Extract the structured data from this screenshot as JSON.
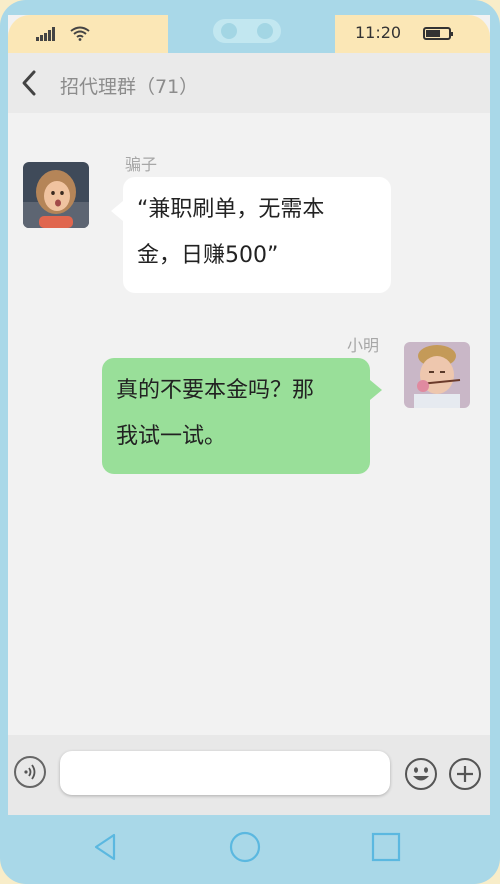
{
  "status_bar": {
    "time": "11:20",
    "signal_icon": "signal-icon",
    "wifi_icon": "wifi-icon",
    "battery_icon": "battery-icon"
  },
  "header": {
    "title": "招代理群（71）",
    "back_icon": "chevron-left-icon"
  },
  "messages": [
    {
      "sender": "骗子",
      "text_line1": "“兼职刷单，无需本",
      "text_line2": "金，日赚500”",
      "side": "left"
    },
    {
      "sender": "小明",
      "text_line1": "真的不要本金吗？那",
      "text_line2": "我试一试。",
      "side": "right"
    }
  ],
  "input_bar": {
    "placeholder": "",
    "voice_icon": "voice-icon",
    "emoji_icon": "emoji-icon",
    "plus_icon": "plus-icon"
  },
  "nav_bar": {
    "back_icon": "triangle-back-icon",
    "home_icon": "circle-home-icon",
    "recent_icon": "square-recent-icon"
  },
  "colors": {
    "frame": "#a9d8e8",
    "status_bg": "#fbe7b6",
    "outgoing_bubble": "#99df99",
    "incoming_bubble": "#ffffff",
    "nav_icon": "#5bb8e0"
  }
}
